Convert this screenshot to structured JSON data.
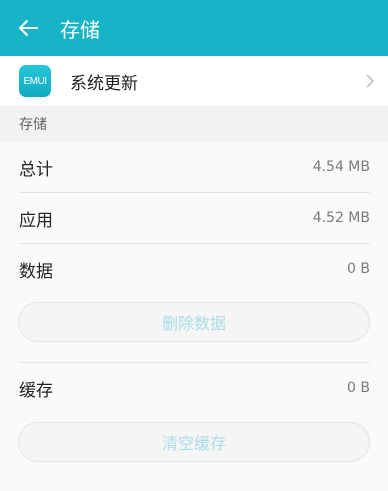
{
  "header": {
    "title": "存储",
    "back_icon": "arrow-left-icon",
    "color": "#16b4c6"
  },
  "app": {
    "icon_text": "EMUI",
    "name": "系统更新",
    "chevron_icon": "chevron-right-icon"
  },
  "storage": {
    "section_label": "存储",
    "total_label": "总计",
    "total_value": "4.54 MB",
    "app_label": "应用",
    "app_value": "4.52 MB",
    "data_label": "数据",
    "data_value": "0 B",
    "clear_data_label": "删除数据",
    "cache_label": "缓存",
    "cache_value": "0 B",
    "clear_cache_label": "清空缓存"
  }
}
